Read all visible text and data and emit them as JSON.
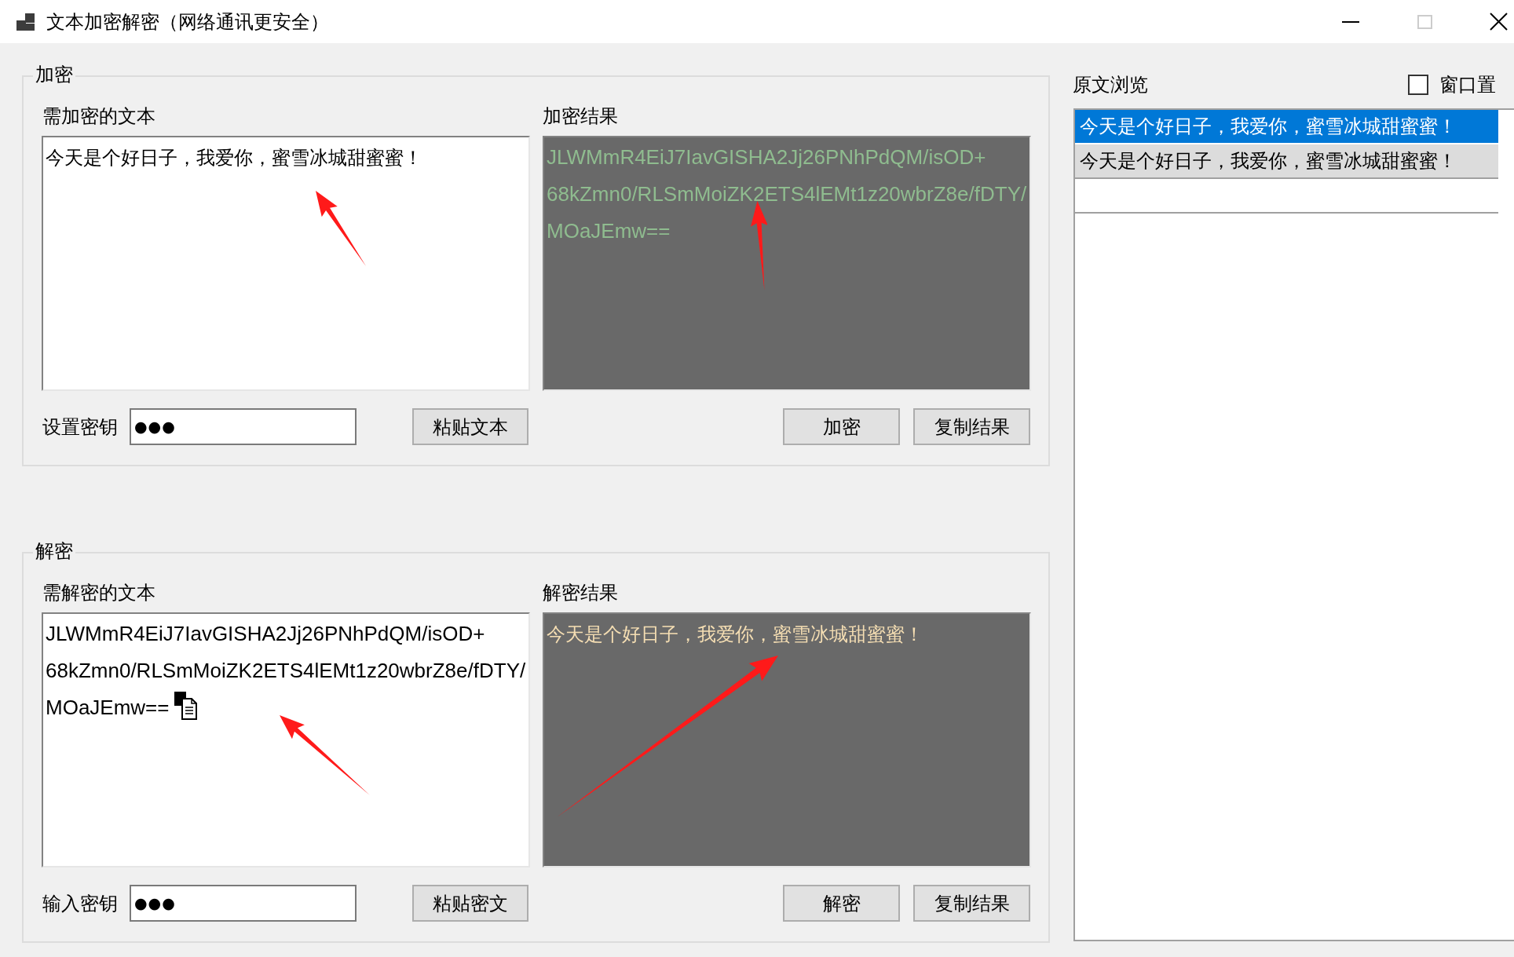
{
  "window": {
    "title": "文本加密解密（网络通讯更安全）",
    "controls": [
      {
        "kind": "minimize",
        "disabled": false
      },
      {
        "kind": "maximize",
        "disabled": true
      },
      {
        "kind": "close",
        "disabled": false
      }
    ]
  },
  "encrypt": {
    "legend": "加密",
    "input_label": "需加密的文本",
    "input_value": "今天是个好日子，我爱你，蜜雪冰城甜蜜蜜！",
    "result_label": "加密结果",
    "result_value": "JLWMmR4EiJ7IavGISHA2Jj26PNhPdQM/isOD+\n68kZmn0/RLSmMoiZK2ETS4lEMt1z20wbrZ8e/fDTY/\nMOaJEmw==",
    "key_label": "设置密钥",
    "key_value": "●●●",
    "paste_button": "粘贴文本",
    "buttons": [
      "加密",
      "复制结果"
    ]
  },
  "decrypt": {
    "legend": "解密",
    "input_label": "需解密的文本",
    "input_value": "JLWMmR4EiJ7IavGISHA2Jj26PNhPdQM/isOD+\n68kZmn0/RLSmMoiZK2ETS4lEMt1z20wbrZ8e/fDTY/\nMOaJEmw==",
    "result_label": "解密结果",
    "result_value": "今天是个好日子，我爱你，蜜雪冰城甜蜜蜜！",
    "key_label": "输入密钥",
    "key_value": "●●●",
    "paste_button": "粘贴密文",
    "buttons": [
      "解密",
      "复制结果"
    ]
  },
  "preview": {
    "title": "原文浏览",
    "pin": {
      "label": "窗口置",
      "checked": false
    },
    "items": [
      {
        "text": "今天是个好日子，我爱你，蜜雪冰城甜蜜蜜！",
        "selected": true
      },
      {
        "text": "今天是个好日子，我爱你，蜜雪冰城甜蜜蜜！",
        "selected": false
      }
    ]
  }
}
